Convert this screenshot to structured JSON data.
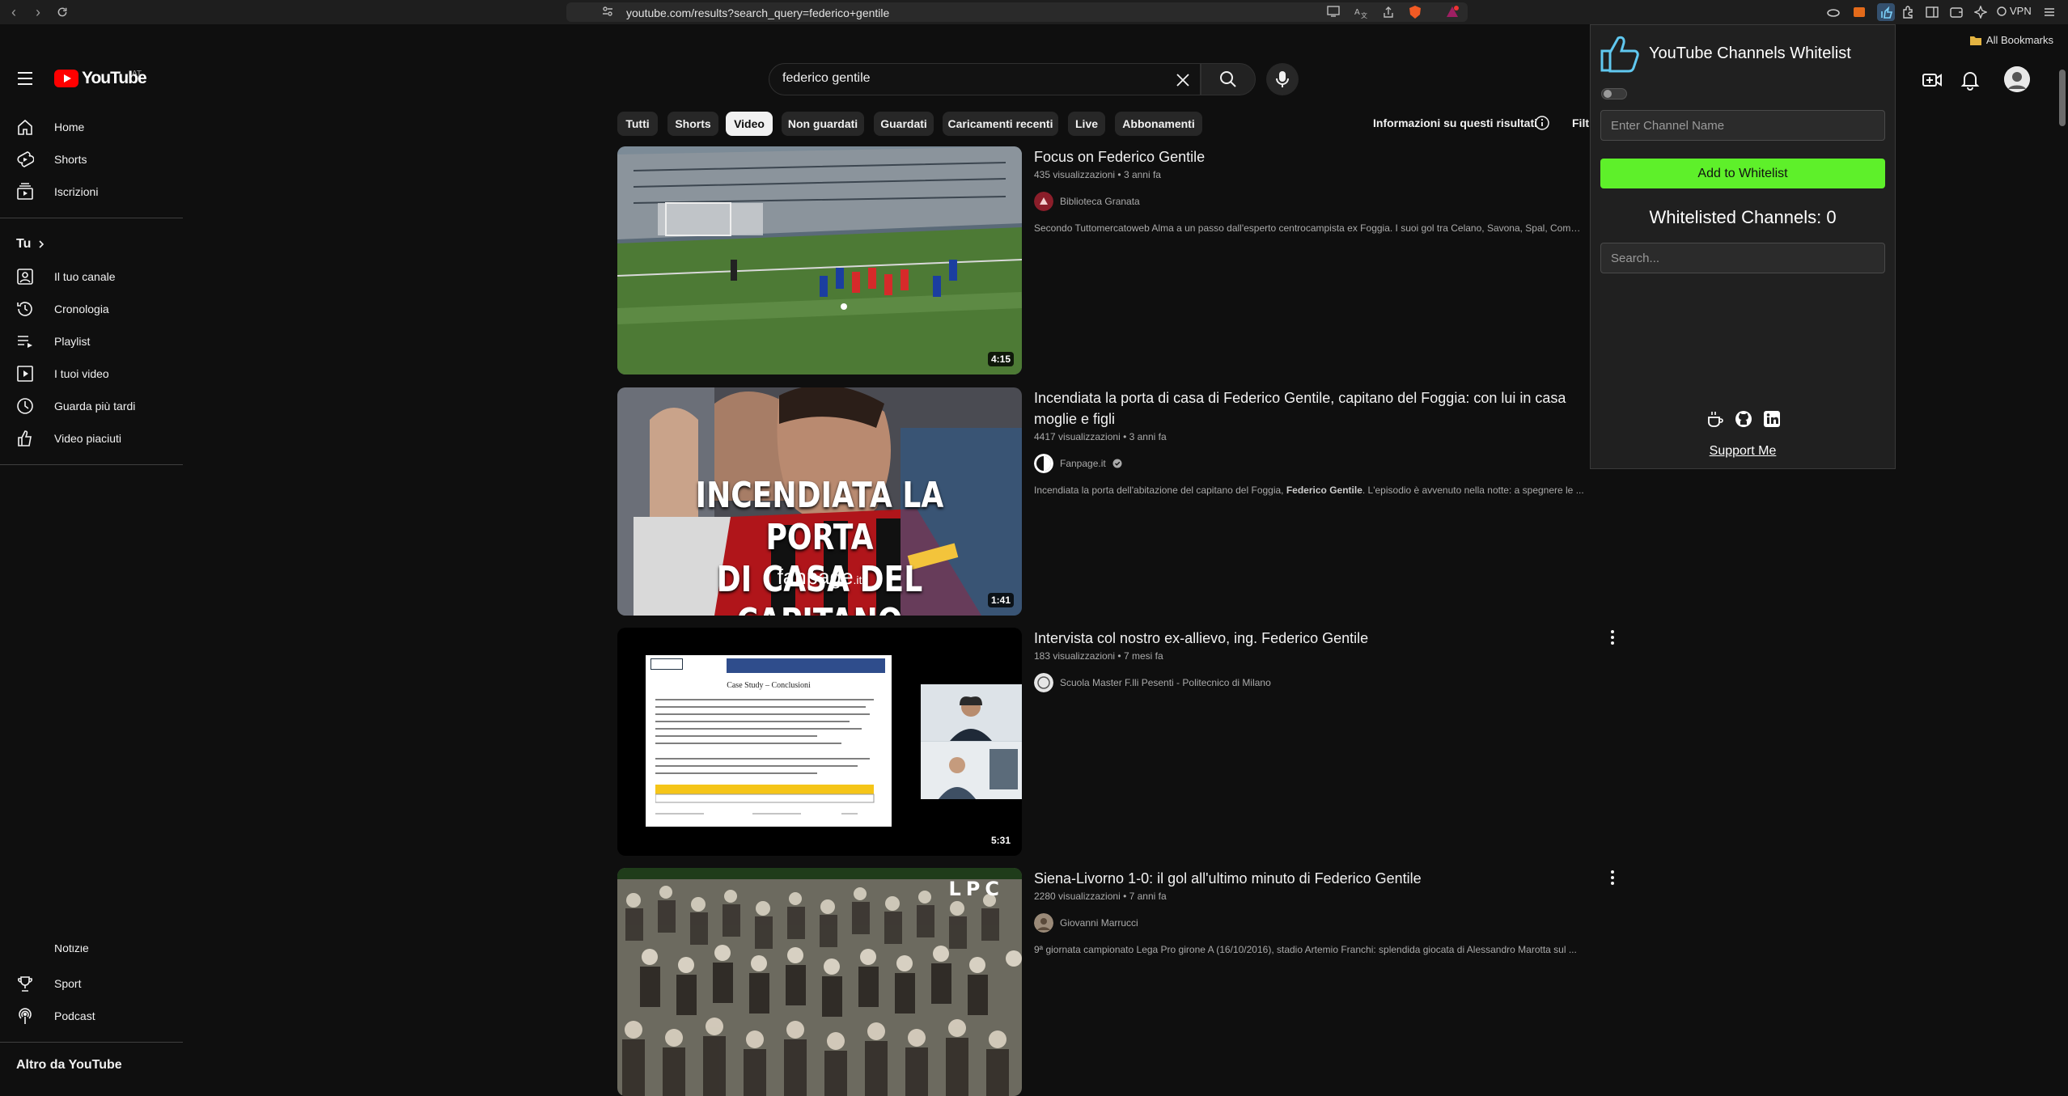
{
  "browser": {
    "url": "youtube.com/results?search_query=federico+gentile",
    "all_bookmarks": "All Bookmarks",
    "vpn": "VPN"
  },
  "header": {
    "logo_text": "YouTube",
    "country_code": "AT",
    "search_value": "federico gentile"
  },
  "sidebar": {
    "main": [
      {
        "label": "Home",
        "icon": "home-icon"
      },
      {
        "label": "Shorts",
        "icon": "shorts-icon"
      },
      {
        "label": "Iscrizioni",
        "icon": "subscriptions-icon"
      }
    ],
    "you_section": "Tu",
    "you_items": [
      {
        "label": "Il tuo canale",
        "icon": "channel-icon"
      },
      {
        "label": "Cronologia",
        "icon": "history-icon"
      },
      {
        "label": "Playlist",
        "icon": "playlist-icon"
      },
      {
        "label": "I tuoi video",
        "icon": "your-videos-icon"
      },
      {
        "label": "Guarda più tardi",
        "icon": "watch-later-icon"
      },
      {
        "label": "Video piaciuti",
        "icon": "liked-icon"
      }
    ],
    "bottom_items": [
      {
        "label": "Notizie",
        "icon": "news-icon"
      },
      {
        "label": "Sport",
        "icon": "sport-icon"
      },
      {
        "label": "Podcast",
        "icon": "podcast-icon"
      }
    ],
    "more_section": "Altro da YouTube"
  },
  "chips": [
    "Tutti",
    "Shorts",
    "Video",
    "Non guardati",
    "Guardati",
    "Caricamenti recenti",
    "Live",
    "Abbonamenti"
  ],
  "active_chip": "Video",
  "results_info": "Informazioni su questi risultati",
  "filter_label": "Filt",
  "videos": [
    {
      "title": "Focus on Federico Gentile",
      "views": "435 visualizzazioni",
      "age": "3 anni fa",
      "channel": "Biblioteca Granata",
      "verified": false,
      "description": "Secondo Tuttomercatoweb Alma a un passo dall'esperto centrocampista ex Foggia. I suoi gol tra Celano, Savona, Spal, Como e ...",
      "duration": "4:15"
    },
    {
      "title": "Incendiata la porta di casa di Federico Gentile, capitano del Foggia: con lui in casa moglie e figli",
      "views": "4417 visualizzazioni",
      "age": "3 anni fa",
      "channel": "Fanpage.it",
      "verified": true,
      "description_pre": "Incendiata la porta dell'abitazione del capitano del Foggia, ",
      "description_bold": "Federico Gentile",
      "description_post": ". L'episodio è avvenuto nella notte: a spegnere le ...",
      "duration": "1:41",
      "overlay_line1": "INCENDIATA LA PORTA",
      "overlay_line2": "DI CASA DEL CAPITANO",
      "overlay_brand": "fanpage",
      "overlay_brand_suffix": ".it"
    },
    {
      "title": "Intervista col nostro ex-allievo, ing. Federico Gentile",
      "views": "183 visualizzazioni",
      "age": "7 mesi fa",
      "channel": "Scuola Master F.lli Pesenti - Politecnico di Milano",
      "verified": false,
      "description": "",
      "duration": "5:31",
      "slide_title": "Case Study – Conclusioni"
    },
    {
      "title": "Siena-Livorno 1-0: il gol all'ultimo minuto di Federico Gentile",
      "views": "2280 visualizzazioni",
      "age": "7 anni fa",
      "channel": "Giovanni Marrucci",
      "verified": false,
      "description": "9ª giornata campionato Lega Pro girone A (16/10/2016), stadio Artemio Franchi: splendida giocata di Alessandro Marotta sul ...",
      "duration": "",
      "overlay_brand": "LPC"
    }
  ],
  "meta_separator": " • ",
  "extension": {
    "title": "YouTube Channels Whitelist",
    "name_placeholder": "Enter Channel Name",
    "add_button": "Add to Whitelist",
    "count_label": "Whitelisted Channels: 0",
    "search_placeholder": "Search...",
    "support": "Support Me",
    "accent_color": "#5ef02a"
  }
}
